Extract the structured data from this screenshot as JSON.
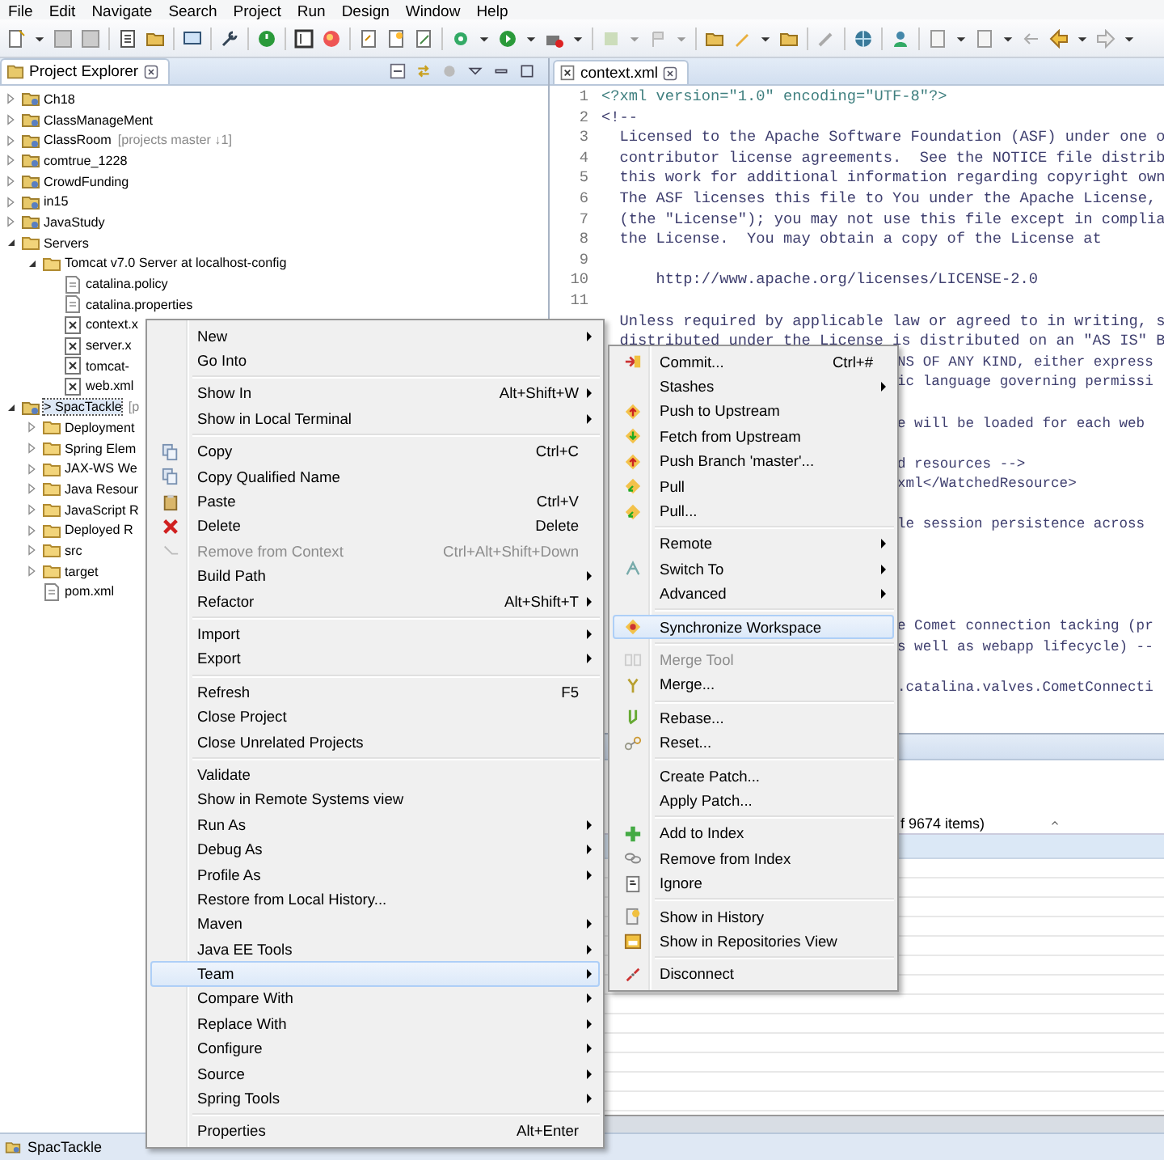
{
  "menu_bar": [
    "File",
    "Edit",
    "Navigate",
    "Search",
    "Project",
    "Run",
    "Design",
    "Window",
    "Help"
  ],
  "project_explorer": {
    "title": "Project Explorer",
    "tree": [
      {
        "label": "Ch18",
        "kind": "project",
        "expanded": false,
        "selected": false
      },
      {
        "label": "ClassManageMent",
        "kind": "project",
        "expanded": false,
        "selected": false
      },
      {
        "label": "ClassRoom",
        "decoration": "[projects master ↓1]",
        "kind": "project",
        "expanded": false,
        "selected": false
      },
      {
        "label": "comtrue_1228",
        "kind": "project",
        "expanded": false,
        "selected": false
      },
      {
        "label": "CrowdFunding",
        "kind": "project",
        "expanded": false,
        "selected": false
      },
      {
        "label": "in15",
        "kind": "project",
        "expanded": false,
        "selected": false
      },
      {
        "label": "JavaStudy",
        "kind": "project",
        "expanded": false,
        "selected": false
      },
      {
        "label": "Servers",
        "kind": "folder",
        "expanded": true,
        "selected": false,
        "children": [
          {
            "label": "Tomcat v7.0 Server at localhost-config",
            "kind": "folder",
            "expanded": true,
            "selected": false,
            "children": [
              {
                "label": "catalina.policy",
                "kind": "file",
                "selected": false
              },
              {
                "label": "catalina.properties",
                "kind": "file",
                "selected": false
              },
              {
                "label": "context.x",
                "kind": "xml",
                "selected": false
              },
              {
                "label": "server.x",
                "kind": "xml",
                "selected": false
              },
              {
                "label": "tomcat-",
                "kind": "xml",
                "selected": false
              },
              {
                "label": "web.xml",
                "kind": "xml",
                "selected": false
              }
            ]
          }
        ]
      },
      {
        "label": "> SpacTackle",
        "decoration": "[p",
        "kind": "project",
        "expanded": true,
        "selected": true,
        "children": [
          {
            "label": "Deployment",
            "kind": "folder",
            "expanded": false,
            "selected": false
          },
          {
            "label": "Spring Elem",
            "kind": "folder",
            "expanded": false,
            "selected": false
          },
          {
            "label": "JAX-WS We",
            "kind": "folder",
            "expanded": false,
            "selected": false
          },
          {
            "label": "Java Resour",
            "kind": "folder",
            "expanded": false,
            "selected": false
          },
          {
            "label": "JavaScript R",
            "kind": "folder",
            "expanded": false,
            "selected": false
          },
          {
            "label": "Deployed R",
            "kind": "folder",
            "expanded": false,
            "selected": false
          },
          {
            "label": "src",
            "kind": "folder",
            "expanded": false,
            "selected": false
          },
          {
            "label": "target",
            "kind": "folder",
            "expanded": false,
            "selected": false
          },
          {
            "label": "pom.xml",
            "kind": "file",
            "selected": false
          }
        ]
      }
    ]
  },
  "editor": {
    "tab": "context.xml",
    "lines": [
      {
        "kind": "line",
        "number": "1",
        "text": "<?xml version=\"1.0\" encoding=\"UTF-8\"?>"
      },
      {
        "kind": "line",
        "number": "2",
        "text": "<!--"
      },
      {
        "kind": "line",
        "number": "3",
        "text": "  Licensed to the Apache Software Foundation (ASF) under one o"
      },
      {
        "kind": "line",
        "number": "4",
        "text": "  contributor license agreements.  See the NOTICE file distrib"
      },
      {
        "kind": "line",
        "number": "5",
        "text": "  this work for additional information regarding copyright own"
      },
      {
        "kind": "line",
        "number": "6",
        "text": "  The ASF licenses this file to You under the Apache License,"
      },
      {
        "kind": "line",
        "number": "7",
        "text": "  (the \"License\"); you may not use this file except in complia"
      },
      {
        "kind": "line",
        "number": "8",
        "text": "  the License.  You may obtain a copy of the License at"
      },
      {
        "kind": "line",
        "number": "9"
      },
      {
        "kind": "line",
        "number": "10",
        "text": "      http://www.apache.org/licenses/LICENSE-2.0"
      },
      {
        "kind": "line",
        "number": "11"
      },
      {
        "kind": "covered",
        "text": "  Unless required by applicable law or agreed to in writing, s"
      },
      {
        "kind": "covered",
        "text": "  distributed under the License is distributed on an \"AS IS\" B"
      },
      {
        "kind": "fragment",
        "text": "NS OF ANY KIND, either express"
      },
      {
        "kind": "fragment",
        "text": "ic language governing permissi"
      },
      {
        "kind": "blank"
      },
      {
        "kind": "fragment",
        "text": "e will be loaded for each web"
      },
      {
        "kind": "blank"
      },
      {
        "kind": "fragment",
        "text": "d resources -->"
      },
      {
        "kind": "fragment",
        "text": "xml</WatchedResource>"
      },
      {
        "kind": "blank"
      },
      {
        "kind": "fragment",
        "text": "le session persistence across"
      },
      {
        "kind": "blank"
      },
      {
        "kind": "blank"
      },
      {
        "kind": "blank"
      },
      {
        "kind": "blank"
      },
      {
        "kind": "fragment",
        "text": "e Comet connection tacking (pr"
      },
      {
        "kind": "fragment",
        "text": "s well as webapp lifecycle) --"
      },
      {
        "kind": "blank"
      },
      {
        "kind": "fragment",
        "text": ".catalina.valves.CometConnecti"
      }
    ]
  },
  "bottom_panel": {
    "item_count": "f 9674 items)"
  },
  "status_bar": {
    "text": "SpacTackle"
  },
  "context_menu": {
    "groups": [
      {
        "items": [
          {
            "label": "New",
            "submenu": true,
            "selected": false,
            "disabled": false
          },
          {
            "label": "Go Into",
            "submenu": false,
            "selected": false,
            "disabled": false
          }
        ]
      },
      {
        "items": [
          {
            "label": "Show In",
            "shortcut": "Alt+Shift+W",
            "submenu": true,
            "selected": false,
            "disabled": false
          },
          {
            "label": "Show in Local Terminal",
            "submenu": true,
            "selected": false,
            "disabled": false
          }
        ]
      },
      {
        "items": [
          {
            "label": "Copy",
            "shortcut": "Ctrl+C",
            "kind": "copy",
            "submenu": false,
            "selected": false,
            "disabled": false
          },
          {
            "label": "Copy Qualified Name",
            "kind": "copy",
            "submenu": false,
            "selected": false,
            "disabled": false
          },
          {
            "label": "Paste",
            "shortcut": "Ctrl+V",
            "kind": "paste",
            "submenu": false,
            "selected": false,
            "disabled": false
          },
          {
            "label": "Delete",
            "shortcut": "Delete",
            "kind": "delete",
            "submenu": false,
            "selected": false,
            "disabled": false
          },
          {
            "label": "Remove from Context",
            "shortcut": "Ctrl+Alt+Shift+Down",
            "kind": "remove",
            "submenu": false,
            "selected": false,
            "disabled": true
          },
          {
            "label": "Build Path",
            "submenu": true,
            "selected": false,
            "disabled": false
          },
          {
            "label": "Refactor",
            "shortcut": "Alt+Shift+T",
            "submenu": true,
            "selected": false,
            "disabled": false
          }
        ]
      },
      {
        "items": [
          {
            "label": "Import",
            "submenu": true,
            "selected": false,
            "disabled": false
          },
          {
            "label": "Export",
            "submenu": true,
            "selected": false,
            "disabled": false
          }
        ]
      },
      {
        "items": [
          {
            "label": "Refresh",
            "shortcut": "F5",
            "submenu": false,
            "selected": false,
            "disabled": false
          },
          {
            "label": "Close Project",
            "submenu": false,
            "selected": false,
            "disabled": false
          },
          {
            "label": "Close Unrelated Projects",
            "submenu": false,
            "selected": false,
            "disabled": false
          }
        ]
      },
      {
        "items": [
          {
            "label": "Validate",
            "submenu": false,
            "selected": false,
            "disabled": false
          },
          {
            "label": "Show in Remote Systems view",
            "submenu": false,
            "selected": false,
            "disabled": false
          },
          {
            "label": "Run As",
            "submenu": true,
            "selected": false,
            "disabled": false
          },
          {
            "label": "Debug As",
            "submenu": true,
            "selected": false,
            "disabled": false
          },
          {
            "label": "Profile As",
            "submenu": true,
            "selected": false,
            "disabled": false
          },
          {
            "label": "Restore from Local History...",
            "submenu": false,
            "selected": false,
            "disabled": false
          },
          {
            "label": "Maven",
            "submenu": true,
            "selected": false,
            "disabled": false
          },
          {
            "label": "Java EE Tools",
            "submenu": true,
            "selected": false,
            "disabled": false
          },
          {
            "label": "Team",
            "submenu": true,
            "selected": true,
            "disabled": false
          },
          {
            "label": "Compare With",
            "submenu": true,
            "selected": false,
            "disabled": false
          },
          {
            "label": "Replace With",
            "submenu": true,
            "selected": false,
            "disabled": false
          },
          {
            "label": "Configure",
            "submenu": true,
            "selected": false,
            "disabled": false
          },
          {
            "label": "Source",
            "submenu": true,
            "selected": false,
            "disabled": false
          },
          {
            "label": "Spring Tools",
            "submenu": true,
            "selected": false,
            "disabled": false
          }
        ]
      },
      {
        "items": [
          {
            "label": "Properties",
            "shortcut": "Alt+Enter",
            "submenu": false,
            "selected": false,
            "disabled": false
          }
        ]
      }
    ]
  },
  "team_submenu": {
    "groups": [
      {
        "items": [
          {
            "label": "Commit...",
            "shortcut": "Ctrl+#",
            "kind": "commit",
            "submenu": false,
            "selected": false,
            "disabled": false
          },
          {
            "label": "Stashes",
            "submenu": true,
            "selected": false,
            "disabled": false
          },
          {
            "label": "Push to Upstream",
            "kind": "push",
            "submenu": false,
            "selected": false,
            "disabled": false
          },
          {
            "label": "Fetch from Upstream",
            "kind": "fetch",
            "submenu": false,
            "selected": false,
            "disabled": false
          },
          {
            "label": "Push Branch 'master'...",
            "kind": "push",
            "submenu": false,
            "selected": false,
            "disabled": false
          },
          {
            "label": "Pull",
            "kind": "pull",
            "submenu": false,
            "selected": false,
            "disabled": false
          },
          {
            "label": "Pull...",
            "kind": "pull",
            "submenu": false,
            "selected": false,
            "disabled": false
          }
        ]
      },
      {
        "items": [
          {
            "label": "Remote",
            "submenu": true,
            "selected": false,
            "disabled": false
          },
          {
            "label": "Switch To",
            "kind": "switch",
            "submenu": true,
            "selected": false,
            "disabled": false
          },
          {
            "label": "Advanced",
            "submenu": true,
            "selected": false,
            "disabled": false
          }
        ]
      },
      {
        "items": [
          {
            "label": "Synchronize Workspace",
            "kind": "sync",
            "submenu": false,
            "selected": true,
            "disabled": false
          }
        ]
      },
      {
        "items": [
          {
            "label": "Merge Tool",
            "kind": "mergetool",
            "submenu": false,
            "selected": false,
            "disabled": true
          },
          {
            "label": "Merge...",
            "kind": "merge",
            "submenu": false,
            "selected": false,
            "disabled": false
          }
        ]
      },
      {
        "items": [
          {
            "label": "Rebase...",
            "kind": "rebase",
            "submenu": false,
            "selected": false,
            "disabled": false
          },
          {
            "label": "Reset...",
            "kind": "reset",
            "submenu": false,
            "selected": false,
            "disabled": false
          }
        ]
      },
      {
        "items": [
          {
            "label": "Create Patch...",
            "submenu": false,
            "selected": false,
            "disabled": false
          },
          {
            "label": "Apply Patch...",
            "submenu": false,
            "selected": false,
            "disabled": false
          }
        ]
      },
      {
        "items": [
          {
            "label": "Add to Index",
            "kind": "add",
            "submenu": false,
            "selected": false,
            "disabled": false
          },
          {
            "label": "Remove from Index",
            "kind": "unindex",
            "submenu": false,
            "selected": false,
            "disabled": false
          },
          {
            "label": "Ignore",
            "kind": "ignore",
            "submenu": false,
            "selected": false,
            "disabled": false
          }
        ]
      },
      {
        "items": [
          {
            "label": "Show in History",
            "kind": "history",
            "submenu": false,
            "selected": false,
            "disabled": false
          },
          {
            "label": "Show in Repositories View",
            "kind": "repo",
            "submenu": false,
            "selected": false,
            "disabled": false
          }
        ]
      },
      {
        "items": [
          {
            "label": "Disconnect",
            "kind": "disconnect",
            "submenu": false,
            "selected": false,
            "disabled": false
          }
        ]
      }
    ]
  }
}
